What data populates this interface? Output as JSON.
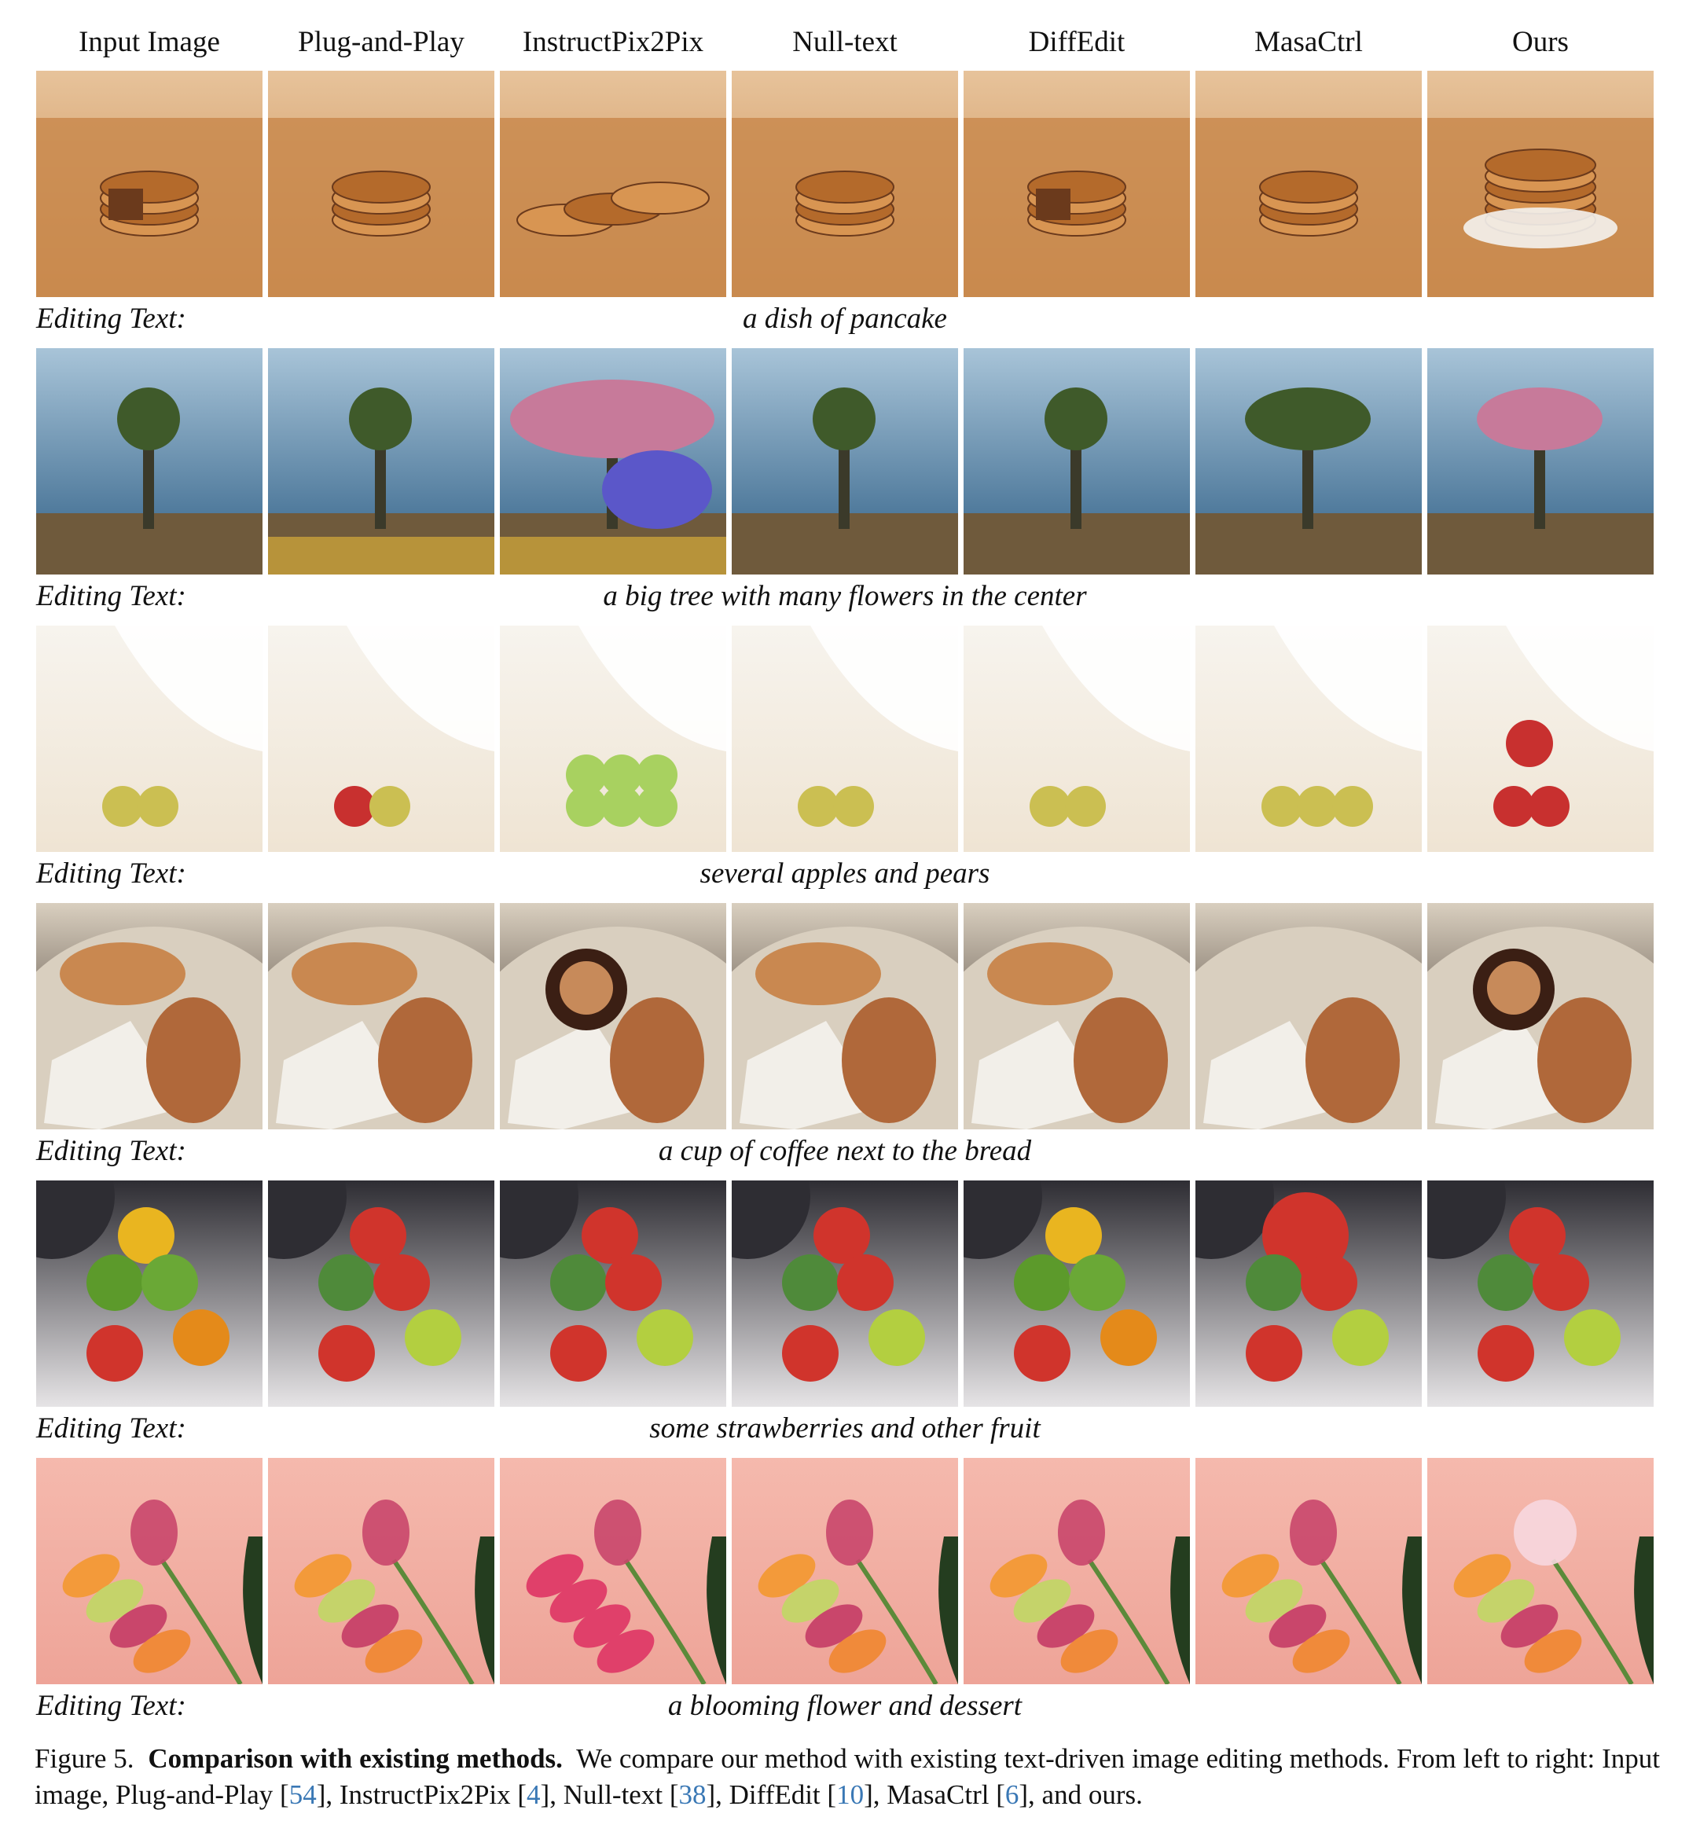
{
  "column_headers": [
    "Input Image",
    "Plug-and-Play",
    "InstructPix2Pix",
    "Null-text",
    "DiffEdit",
    "MasaCtrl",
    "Ours"
  ],
  "editing_label": "Editing Text:",
  "rows": [
    {
      "editing_text": "a dish of pancake",
      "scene": "pancake",
      "palette": {
        "bg": "#c98a4e",
        "bg2": "#e7c39b",
        "subject": "#b46a2b",
        "accent": "#6b3a1c"
      }
    },
    {
      "editing_text": "a big tree with many flowers in the center",
      "scene": "tree",
      "palette": {
        "bg": "#2f5f86",
        "bg2": "#a8c4d8",
        "subject": "#3b3a2a",
        "accent": "#c77a9a"
      }
    },
    {
      "editing_text": "several apples and pears",
      "scene": "apples",
      "palette": {
        "bg": "#efe4d3",
        "bg2": "#f7f4ee",
        "subject": "#b7b44a",
        "accent": "#c8302f"
      }
    },
    {
      "editing_text": "a cup of coffee next to the bread",
      "scene": "coffee",
      "palette": {
        "bg": "#1b0f08",
        "bg2": "#d9cfbf",
        "subject": "#b0683a",
        "accent": "#f2efe9"
      }
    },
    {
      "editing_text": "some strawberries and other fruit",
      "scene": "fruit",
      "palette": {
        "bg": "#e6e4e6",
        "bg2": "#2e2d33",
        "subject": "#d0342c",
        "accent": "#e9b520"
      }
    },
    {
      "editing_text": "a blooming flower and dessert",
      "scene": "macaron",
      "palette": {
        "bg": "#eea498",
        "bg2": "#f5b9ad",
        "subject": "#c9466b",
        "accent": "#f3a14a"
      }
    }
  ],
  "caption": {
    "figure_label": "Figure 5.",
    "title": "Comparison with existing methods.",
    "text_part1": "We compare our method with existing text-driven image editing methods. From left to right: Input image, Plug-and-Play [",
    "ref1": "54",
    "text_part2": "], InstructPix2Pix [",
    "ref2": "4",
    "text_part3": "], Null-text [",
    "ref3": "38",
    "text_part4": "], DiffEdit [",
    "ref4": "10",
    "text_part5": "], MasaCtrl [",
    "ref5": "6",
    "text_part6": "], and ours."
  }
}
